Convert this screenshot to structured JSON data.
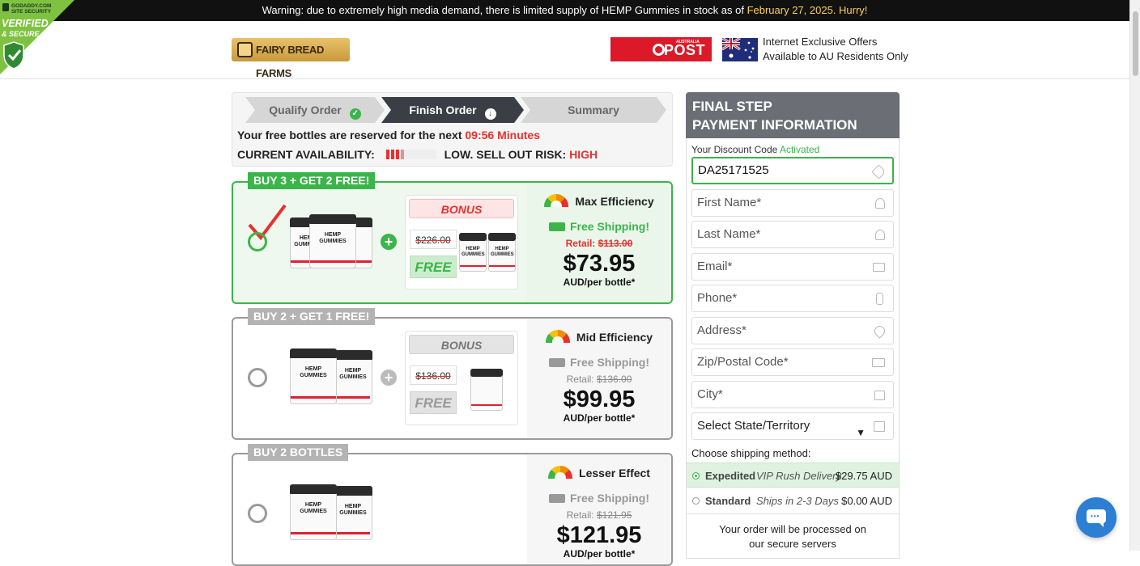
{
  "topbar": {
    "warning": "Warning: due to extremely high media demand, there is limited supply of HEMP Gummies in stock as of",
    "date": "February 27, 2025. Hurry!"
  },
  "badge": {
    "line1": "GODADDY.COM",
    "line2": "SITE SECURITY",
    "line3": "VERIFIED",
    "line4": "& SECURE"
  },
  "header": {
    "logo": "FAIRY BREAD FARMS",
    "post_small": "AUSTRALIA",
    "post_text": "POST",
    "offers_line1": "Internet Exclusive Offers",
    "offers_line2": "Available to AU Residents Only"
  },
  "steps": [
    {
      "label": "Qualify Order"
    },
    {
      "label": "Finish Order"
    },
    {
      "label": "Summary"
    }
  ],
  "reserve": {
    "text": "Your free bottles are reserved for the next",
    "timer": "09:56 Minutes"
  },
  "availability": {
    "label": "CURRENT AVAILABILITY:",
    "risk_label": "LOW. SELL OUT RISK:",
    "risk": "HIGH"
  },
  "packages": [
    {
      "tag": "BUY 3 + GET 2 FREE!",
      "bonus": "BONUS",
      "was": "$226.00",
      "free": "FREE",
      "efficiency": "Max Efficiency",
      "shipping": "Free Shipping!",
      "retail_label": "Retail:",
      "retail": "$113.00",
      "price": "$73.95",
      "per": "AUD/per bottle*",
      "selected": true
    },
    {
      "tag": "BUY 2 + GET 1 FREE!",
      "bonus": "BONUS",
      "was": "$136.00",
      "free": "FREE",
      "efficiency": "Mid Efficiency",
      "shipping": "Free Shipping!",
      "retail_label": "Retail:",
      "retail": "$136.00",
      "price": "$99.95",
      "per": "AUD/per bottle*",
      "selected": false
    },
    {
      "tag": "BUY 2 BOTTLES",
      "efficiency": "Lesser Effect",
      "shipping": "Free Shipping!",
      "retail_label": "Retail:",
      "retail": "$121.95",
      "price": "$121.95",
      "per": "AUD/per bottle*",
      "selected": false
    }
  ],
  "jar_label": "HEMP GUMMIES",
  "form": {
    "head_line1": "FINAL STEP",
    "head_line2": "PAYMENT INFORMATION",
    "discount_label": "Your Discount Code",
    "discount_status": "Activated",
    "discount_code": "DA25171525",
    "first_name": "First Name*",
    "last_name": "Last Name*",
    "email": "Email*",
    "phone": "Phone*",
    "address": "Address*",
    "zip": "Zip/Postal Code*",
    "city": "City*",
    "state": "Select State/Territory",
    "shipping_label": "Choose shipping method:",
    "shipping": [
      {
        "name": "Expedited",
        "desc": "VIP Rush Delivery",
        "price": "$29.75 AUD",
        "selected": true
      },
      {
        "name": "Standard",
        "desc": "Ships in 2-3 Days",
        "price": "$0.00 AUD",
        "selected": false
      }
    ],
    "secure_line1": "Your order will be processed on",
    "secure_line2": "our secure servers"
  },
  "colors": {
    "accent": "#3bb54a",
    "alert": "#e8312f",
    "header_dark": "#111111"
  }
}
